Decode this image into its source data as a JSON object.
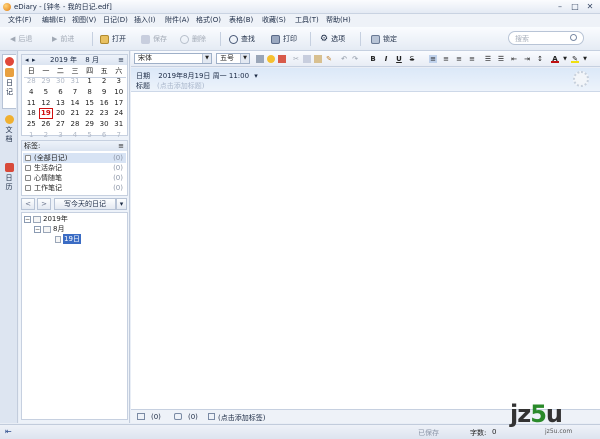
{
  "window": {
    "title": "eDiary - [钟冬 - 我的日记.edf]",
    "minimize": "–",
    "maximize": "□",
    "close": "✕"
  },
  "menu": [
    "文件(F)",
    "编辑(E)",
    "视图(V)",
    "日记(D)",
    "插入(I)",
    "附件(A)",
    "格式(O)",
    "表格(B)",
    "收藏(S)",
    "工具(T)",
    "帮助(H)"
  ],
  "toolbar": {
    "back": "后退",
    "forward": "前进",
    "open": "打开",
    "save": "保存",
    "delete": "删除",
    "find": "查找",
    "print": "打印",
    "options": "选项",
    "lock": "锁定",
    "search_placeholder": "搜索"
  },
  "left_tabs": {
    "diary": "日记",
    "docs": "文档",
    "calendar": "日历"
  },
  "calendar": {
    "year_label": "2019 年",
    "month_label": "8 月",
    "prev": "◂",
    "next": "▸",
    "menu": "≡",
    "weekdays": [
      "日",
      "一",
      "二",
      "三",
      "四",
      "五",
      "六"
    ],
    "days": [
      "28",
      "29",
      "30",
      "31",
      "1",
      "2",
      "3",
      "4",
      "5",
      "6",
      "7",
      "8",
      "9",
      "10",
      "11",
      "12",
      "13",
      "14",
      "15",
      "16",
      "17",
      "18",
      "19",
      "20",
      "21",
      "22",
      "23",
      "24",
      "25",
      "26",
      "27",
      "28",
      "29",
      "30",
      "31",
      "1",
      "2",
      "3",
      "4",
      "5",
      "6",
      "7"
    ],
    "today": "19"
  },
  "tags": {
    "header": "标签:",
    "items": [
      {
        "label": "(全部日记)",
        "count": "(0)"
      },
      {
        "label": "生活杂记",
        "count": "(0)"
      },
      {
        "label": "心情随笔",
        "count": "(0)"
      },
      {
        "label": "工作笔记",
        "count": "(0)"
      }
    ]
  },
  "nav": {
    "prev": "<",
    "next": ">",
    "write_today": "写今天的日记",
    "menu": "▾"
  },
  "tree": {
    "year": "2019年",
    "month": "8月",
    "day": "19日"
  },
  "format": {
    "font": "宋体",
    "size": "五号"
  },
  "entry": {
    "date_label": "日期",
    "date_value": "2019年8月19日 周一 11:00",
    "date_dd": "▾",
    "title_label": "标题",
    "title_placeholder": "(点击添加标题)"
  },
  "bottom": {
    "attach_count": "(0)",
    "comment_count": "(0)",
    "tag_prompt": "(点击添加标签)"
  },
  "status": {
    "saved": "已保存",
    "wordcount_label": "字数:",
    "wordcount": "0"
  },
  "watermark": {
    "logo_a": "jz",
    "logo_b": "5",
    "logo_c": "u",
    "sub": "jz5u.com"
  }
}
